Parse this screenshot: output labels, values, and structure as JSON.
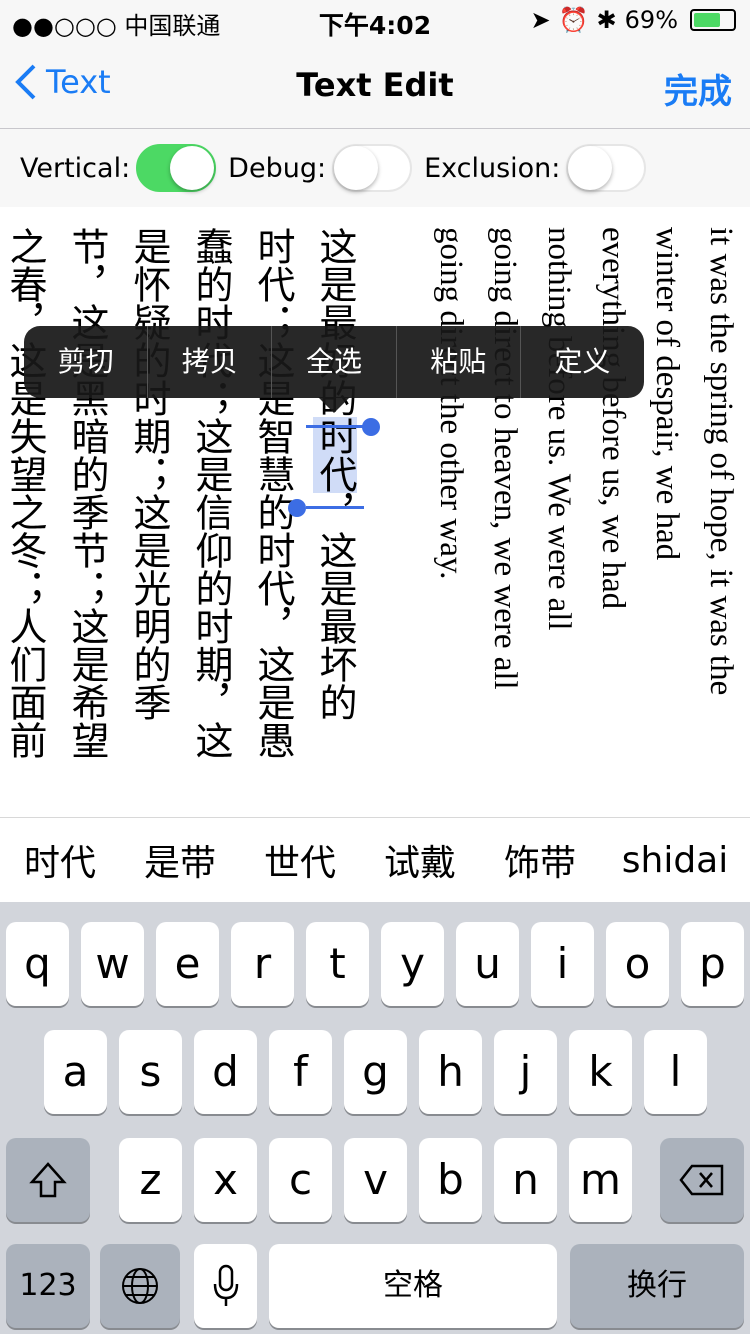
{
  "status": {
    "carrier": "●●○○○ 中国联通",
    "time": "下午4:02",
    "battery": "69%",
    "battery_level": 0.69
  },
  "nav": {
    "back": "Text",
    "title": "Text Edit",
    "done": "完成"
  },
  "toggles": [
    {
      "label": "Vertical:",
      "on": true
    },
    {
      "label": "Debug:",
      "on": false
    },
    {
      "label": "Exclusion:",
      "on": false
    }
  ],
  "text_columns": {
    "en": [
      "it was the spring of hope, it was the",
      "winter of despair, we had",
      "everything before us, we had",
      "nothing before us. We were all",
      "going direct to heaven, we were all",
      "going direct the other way."
    ],
    "zh_c1_pre": "这是最好的",
    "zh_c1_sel": "时代",
    "zh_c1_post": "，这是最坏的",
    "zh": [
      "时代；这是智慧的时代，这是愚",
      "蠢的时代；这是信仰的时期，这",
      "是怀疑的时期；这是光明的季",
      "节，这是黑暗的季节；这是希望",
      "之春，这是失望之冬；人们面前"
    ]
  },
  "context_menu": [
    "剪切",
    "拷贝",
    "全选",
    "粘贴",
    "定义"
  ],
  "candidates": [
    "时代",
    "是带",
    "世代",
    "试戴",
    "饰带",
    "shidai"
  ],
  "keyboard": {
    "row1": [
      "q",
      "w",
      "e",
      "r",
      "t",
      "y",
      "u",
      "i",
      "o",
      "p"
    ],
    "row2": [
      "a",
      "s",
      "d",
      "f",
      "g",
      "h",
      "j",
      "k",
      "l"
    ],
    "row3": [
      "z",
      "x",
      "c",
      "v",
      "b",
      "n",
      "m"
    ],
    "num": "123",
    "space": "空格",
    "return": "换行"
  },
  "colors": {
    "accent": "#1a7cf5",
    "switch_on": "#4cd964",
    "selection": "#d0dcf7"
  }
}
